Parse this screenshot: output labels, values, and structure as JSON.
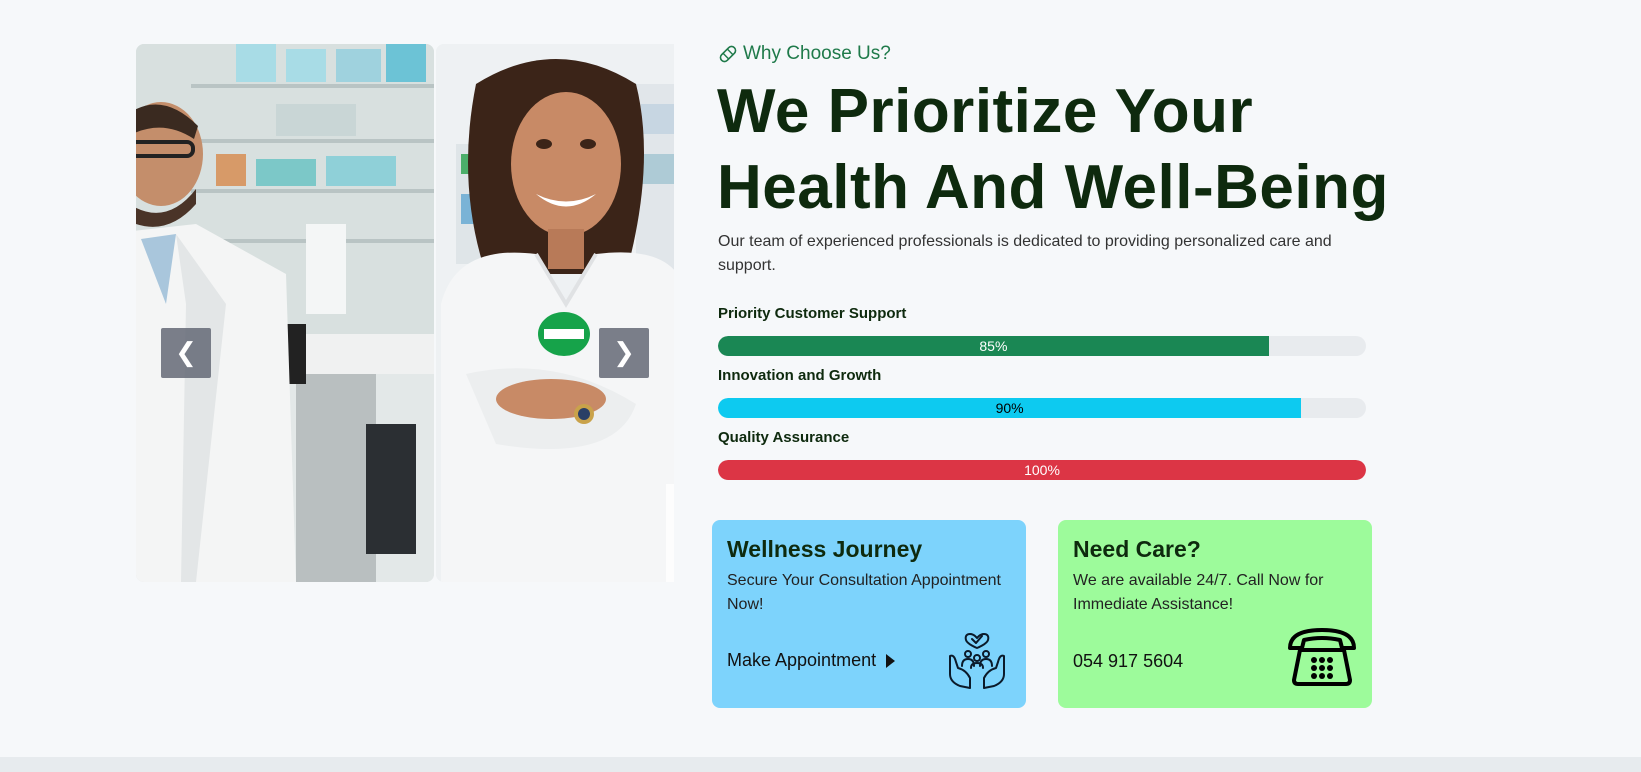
{
  "carousel": {
    "prev_label": "❮",
    "next_label": "❯",
    "slides": [
      "pharmacist-man",
      "pharmacist-woman"
    ]
  },
  "section": {
    "eyebrow": "Why Choose Us?",
    "eyebrow_icon": "bandage-icon",
    "headline": "We Prioritize Your Health And Well-Being",
    "lead": "Our team of experienced professionals is dedicated to providing personalized care and support."
  },
  "skills": [
    {
      "label": "Priority Customer Support",
      "percent_text": "85%",
      "value": 85,
      "color": "#1a8754"
    },
    {
      "label": "Innovation and Growth",
      "percent_text": "90%",
      "value": 90,
      "color": "#0dcaf0"
    },
    {
      "label": "Quality Assurance",
      "percent_text": "100%",
      "value": 100,
      "color": "#dc3545"
    }
  ],
  "cards": {
    "wellness": {
      "title": "Wellness Journey",
      "text": "Secure Your Consultation Appointment Now!",
      "link": "Make Appointment",
      "icon": "care-hands-icon",
      "bg": "#7dd3fc"
    },
    "care": {
      "title": "Need Care?",
      "text": "We are available 24/7. Call Now for Immediate Assistance!",
      "phone": "054 917 5604",
      "icon": "telephone-icon",
      "bg": "#9dfb9b"
    }
  },
  "colors": {
    "accent_green": "#1f7a4a",
    "heading": "#0e2a0e",
    "page_bg": "#f6f8fa"
  }
}
